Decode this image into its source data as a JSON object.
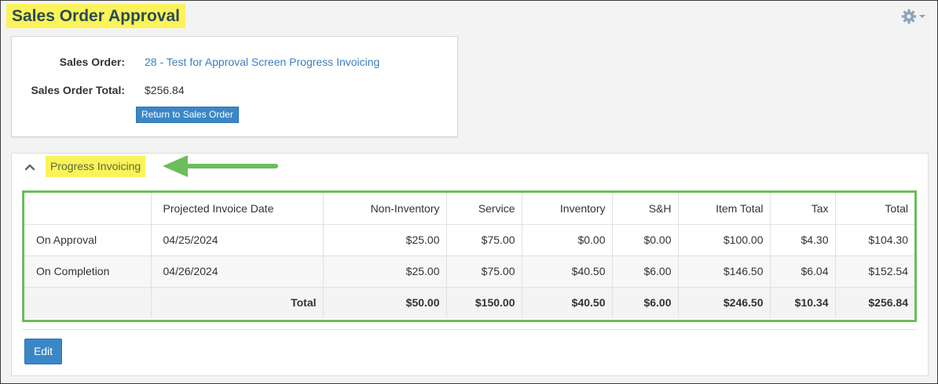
{
  "page": {
    "title": "Sales Order Approval"
  },
  "toolbar": {
    "settings_icon": "gear-icon"
  },
  "order": {
    "sales_order_label": "Sales Order:",
    "sales_order_value": "28 - Test for Approval Screen Progress Invoicing",
    "total_label": "Sales Order Total:",
    "total_value": "$256.84",
    "return_button": "Return to Sales Order"
  },
  "progress": {
    "section_title": "Progress Invoicing",
    "collapse_icon": "chevron-up-icon",
    "columns": [
      "",
      "Projected Invoice Date",
      "Non-Inventory",
      "Service",
      "Inventory",
      "S&H",
      "Item Total",
      "Tax",
      "Total"
    ],
    "rows": [
      {
        "label": "On Approval",
        "date": "04/25/2024",
        "non_inventory": "$25.00",
        "service": "$75.00",
        "inventory": "$0.00",
        "sh": "$0.00",
        "item_total": "$100.00",
        "tax": "$4.30",
        "total": "$104.30"
      },
      {
        "label": "On Completion",
        "date": "04/26/2024",
        "non_inventory": "$25.00",
        "service": "$75.00",
        "inventory": "$40.50",
        "sh": "$6.00",
        "item_total": "$146.50",
        "tax": "$6.04",
        "total": "$152.54"
      }
    ],
    "totals": {
      "label": "Total",
      "non_inventory": "$50.00",
      "service": "$150.00",
      "inventory": "$40.50",
      "sh": "$6.00",
      "item_total": "$246.50",
      "tax": "$10.34",
      "total": "$256.84"
    },
    "edit_button": "Edit"
  },
  "colors": {
    "highlight": "#fbf35a",
    "table_outline": "#6cbd5c",
    "arrow": "#6cbd5c",
    "button": "#3a87c8",
    "link": "#3a7fc1"
  }
}
